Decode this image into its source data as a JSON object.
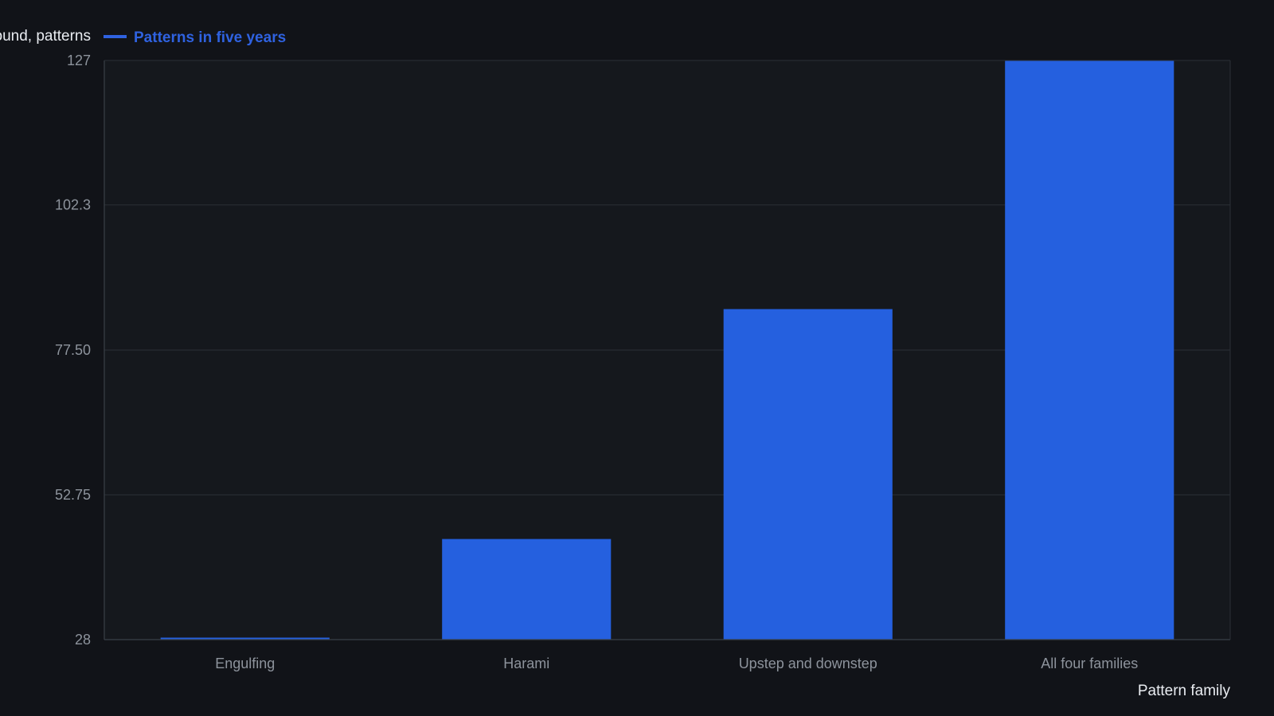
{
  "chart_data": {
    "type": "bar",
    "categories": [
      "Engulfing",
      "Harami",
      "Upstep and downstep",
      "All four families"
    ],
    "series": [
      {
        "name": "Patterns in five years",
        "values": [
          28,
          45.2,
          84.5,
          127
        ],
        "color": "#2560df"
      }
    ],
    "ylabel": "Patterns found, patterns",
    "ylabel_visible": "ound, patterns",
    "xlabel": "Pattern family",
    "ylim": [
      28,
      127
    ],
    "yticks": [
      "28",
      "52.75",
      "77.50",
      "102.3",
      "127"
    ],
    "grid": true,
    "legend_position": "top-left"
  },
  "colors": {
    "background": "#111318",
    "plot_background": "#15181d",
    "grid": "#2a2f36",
    "axis": "#3a4048",
    "bar": "#2560df",
    "legend": "#2f62e0"
  }
}
